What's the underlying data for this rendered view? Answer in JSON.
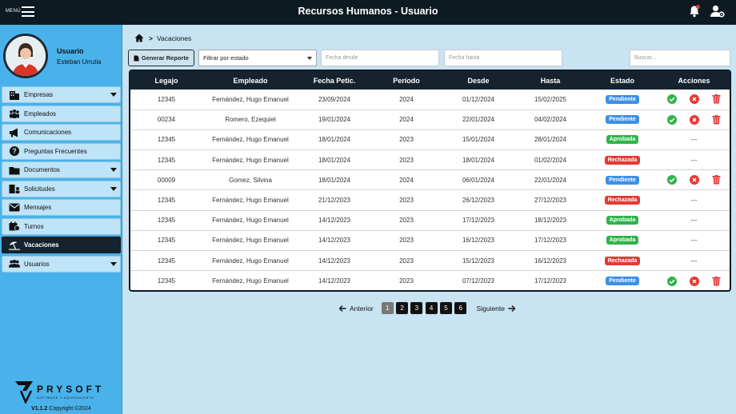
{
  "header": {
    "menu_label": "MENÚ",
    "title": "Recursos Humanos - Usuario",
    "icons": [
      "hamburger-icon",
      "bell-icon",
      "user-gear-icon"
    ]
  },
  "sidebar": {
    "user_role": "Usuario",
    "user_name": "Esteban Urrutia",
    "items": [
      {
        "label": "Empresas",
        "icon": "building-icon",
        "has_submenu": true
      },
      {
        "label": "Empleados",
        "icon": "people-icon",
        "has_submenu": false
      },
      {
        "label": "Comunicaciones",
        "icon": "megaphone-icon",
        "has_submenu": false
      },
      {
        "label": "Preguntas Frecuentes",
        "icon": "question-icon",
        "has_submenu": false
      },
      {
        "label": "Documentos",
        "icon": "folder-icon",
        "has_submenu": true
      },
      {
        "label": "Solicitudes",
        "icon": "building-user-icon",
        "has_submenu": true
      },
      {
        "label": "Mensajes",
        "icon": "envelope-icon",
        "has_submenu": false
      },
      {
        "label": "Turnos",
        "icon": "calendar-icon",
        "has_submenu": false
      },
      {
        "label": "Vacaciones",
        "icon": "umbrella-beach-icon",
        "has_submenu": false,
        "active": true
      },
      {
        "label": "Usuarios",
        "icon": "users-icon",
        "has_submenu": true
      }
    ],
    "logo_text": "PRYSOFT",
    "logo_subtext": "SOFTWARE Y EQUIPAMIENTO",
    "version": "V1.1.2",
    "copyright": "Copyright ©2024"
  },
  "breadcrumb": {
    "current": "Vacaciones"
  },
  "toolbar": {
    "report_button": "Generar Reporte",
    "filter_select": "Filtrar por estado",
    "date_from_placeholder": "Fecha desde",
    "date_to_placeholder": "Fecha hasta",
    "search_placeholder": "Buscar..."
  },
  "table": {
    "columns": [
      "Legajo",
      "Empleado",
      "Fecha Petic.",
      "Período",
      "Desde",
      "Hasta",
      "Estado",
      "Acciones"
    ],
    "rows": [
      {
        "legajo": "12345",
        "empleado": "Fernández, Hugo Emanuel",
        "fecha": "23/09/2024",
        "periodo": "2024",
        "desde": "01/12/2024",
        "hasta": "15/02/2025",
        "estado": "Pendiente",
        "actions": true
      },
      {
        "legajo": "00234",
        "empleado": "Romero, Ezequiel",
        "fecha": "19/01/2024",
        "periodo": "2024",
        "desde": "22/01/2024",
        "hasta": "04/02/2024",
        "estado": "Pendiente",
        "actions": true
      },
      {
        "legajo": "12345",
        "empleado": "Fernández, Hugo Emanuel",
        "fecha": "18/01/2024",
        "periodo": "2023",
        "desde": "15/01/2024",
        "hasta": "28/01/2024",
        "estado": "Aprobada",
        "actions": false
      },
      {
        "legajo": "12345",
        "empleado": "Fernández, Hugo Emanuel",
        "fecha": "18/01/2024",
        "periodo": "2023",
        "desde": "18/01/2024",
        "hasta": "01/02/2024",
        "estado": "Rechazada",
        "actions": false
      },
      {
        "legajo": "00009",
        "empleado": "Gomez, Silvina",
        "fecha": "18/01/2024",
        "periodo": "2024",
        "desde": "06/01/2024",
        "hasta": "22/01/2024",
        "estado": "Pendiente",
        "actions": true
      },
      {
        "legajo": "12345",
        "empleado": "Fernández, Hugo Emanuel",
        "fecha": "21/12/2023",
        "periodo": "2023",
        "desde": "26/12/2023",
        "hasta": "27/12/2023",
        "estado": "Rechazada",
        "actions": false
      },
      {
        "legajo": "12345",
        "empleado": "Fernández, Hugo Emanuel",
        "fecha": "14/12/2023",
        "periodo": "2023",
        "desde": "17/12/2023",
        "hasta": "18/12/2023",
        "estado": "Aprobada",
        "actions": false
      },
      {
        "legajo": "12345",
        "empleado": "Fernández, Hugo Emanuel",
        "fecha": "14/12/2023",
        "periodo": "2023",
        "desde": "16/12/2023",
        "hasta": "17/12/2023",
        "estado": "Aprobada",
        "actions": false
      },
      {
        "legajo": "12345",
        "empleado": "Fernández, Hugo Emanuel",
        "fecha": "14/12/2023",
        "periodo": "2023",
        "desde": "15/12/2023",
        "hasta": "16/12/2023",
        "estado": "Rechazada",
        "actions": false
      },
      {
        "legajo": "12345",
        "empleado": "Fernández, Hugo Emanuel",
        "fecha": "14/12/2023",
        "periodo": "2023",
        "desde": "07/12/2023",
        "hasta": "17/12/2023",
        "estado": "Pendiente",
        "actions": true
      }
    ],
    "no_action_text": "---"
  },
  "pagination": {
    "prev": "Anterior",
    "next": "Siguiente",
    "pages": [
      "1",
      "2",
      "3",
      "4",
      "5",
      "6"
    ],
    "current": "1"
  },
  "colors": {
    "topbar": "#0e1a22",
    "sidebar": "#4ab2ea",
    "pending": "#3d8fe6",
    "approved": "#2eb44a",
    "rejected": "#e53935"
  }
}
